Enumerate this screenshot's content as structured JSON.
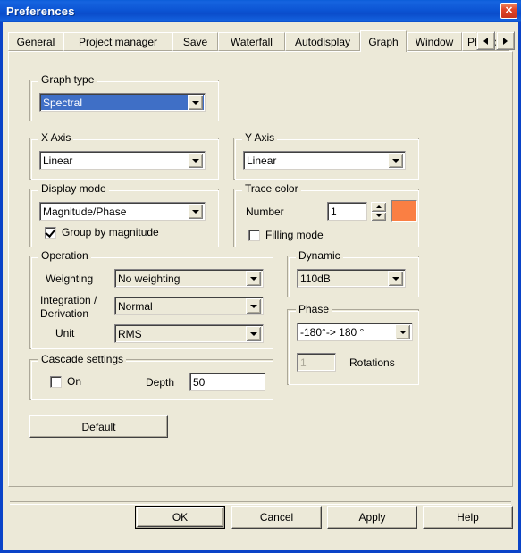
{
  "window": {
    "title": "Preferences",
    "close_label": "✕"
  },
  "tabs": [
    {
      "label": "General",
      "active": false
    },
    {
      "label": "Project manager",
      "active": false
    },
    {
      "label": "Save",
      "active": false
    },
    {
      "label": "Waterfall",
      "active": false
    },
    {
      "label": "Autodisplay",
      "active": false
    },
    {
      "label": "Graph",
      "active": true
    },
    {
      "label": "Window",
      "active": false
    },
    {
      "label": "Physic",
      "active": false
    }
  ],
  "tab_scroll": {
    "prev": "◄",
    "next": "►"
  },
  "graph_type": {
    "legend": "Graph type",
    "value": "Spectral"
  },
  "x_axis": {
    "legend": "X Axis",
    "value": "Linear"
  },
  "y_axis": {
    "legend": "Y Axis",
    "value": "Linear"
  },
  "display_mode": {
    "legend": "Display mode",
    "value": "Magnitude/Phase",
    "group_by_magnitude_label": "Group by magnitude",
    "group_by_magnitude_checked": true
  },
  "trace_color": {
    "legend": "Trace color",
    "number_label": "Number",
    "number_value": "1",
    "color": "#FA7F43",
    "filling_mode_label": "Filling mode",
    "filling_mode_checked": false
  },
  "operation": {
    "legend": "Operation",
    "weighting_label": "Weighting",
    "weighting_value": "No weighting",
    "integration_label_line1": "Integration /",
    "integration_label_line2": "Derivation",
    "integration_value": "Normal",
    "unit_label": "Unit",
    "unit_value": "RMS"
  },
  "dynamic": {
    "legend": "Dynamic",
    "value": "110dB"
  },
  "phase": {
    "legend": "Phase",
    "value": "-180°-> 180 °",
    "rotations_value": "1",
    "rotations_label": "Rotations"
  },
  "cascade": {
    "legend": "Cascade settings",
    "on_label": "On",
    "on_checked": false,
    "depth_label": "Depth",
    "depth_value": "50"
  },
  "default_button": {
    "label": "Default"
  },
  "footer": {
    "ok": "OK",
    "cancel": "Cancel",
    "apply": "Apply",
    "help": "Help"
  }
}
